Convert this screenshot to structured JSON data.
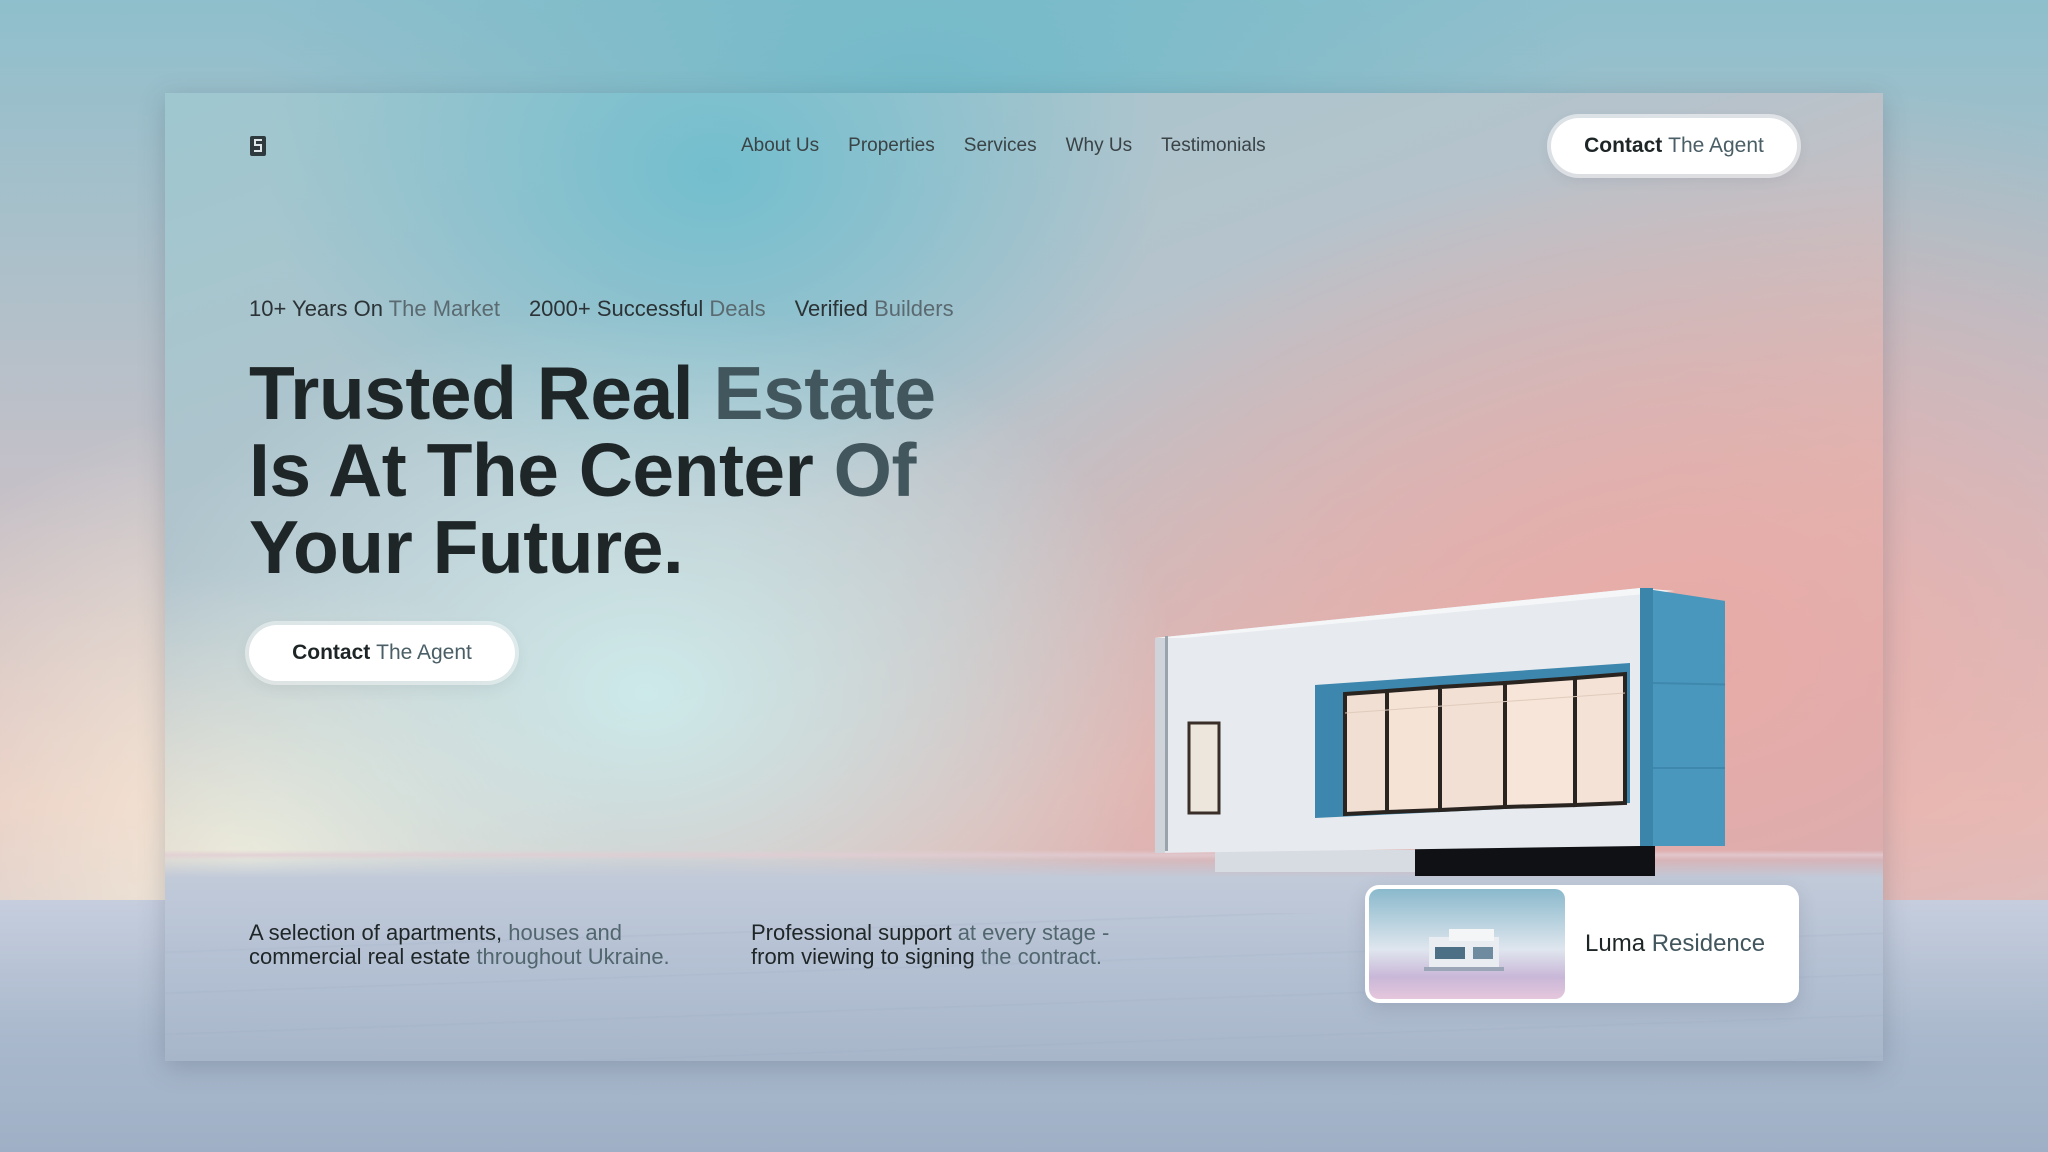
{
  "brand": {
    "logo_icon": "building-letter-s-logo"
  },
  "nav": {
    "items": [
      "About Us",
      "Properties",
      "Services",
      "Why Us",
      "Testimonials"
    ]
  },
  "header_cta": {
    "label_main": "Contact",
    "label_soft": "The Agent"
  },
  "hero": {
    "stats": [
      {
        "main": "10+ Years On",
        "soft": "The Market"
      },
      {
        "main": "2000+ Successful",
        "soft": "Deals"
      },
      {
        "main": "Verified",
        "soft": "Builders"
      }
    ],
    "headline": {
      "line1_main": "Trusted Real",
      "line1_soft": "Estate",
      "line2_main": "Is At The Center",
      "line2_soft": "Of",
      "line3": "Your Future."
    },
    "cta": {
      "label_main": "Contact",
      "label_soft": "The Agent"
    }
  },
  "footer": {
    "blurb1": {
      "l1_main": "A selection of apartments,",
      "l1_soft": "houses and",
      "l2_main": "commercial real estate",
      "l2_soft": "throughout Ukraine."
    },
    "blurb2": {
      "l1_main": "Professional support",
      "l1_soft": "at every stage -",
      "l2_main": "from viewing to signing",
      "l2_soft": "the contract."
    },
    "residence_card": {
      "name_main": "Luma",
      "name_soft": "Residence"
    }
  },
  "colors": {
    "text_dark": "#1f2628",
    "text_soft": "#42565e",
    "house_blue": "#4a97bd",
    "house_white": "#e9ecef"
  }
}
